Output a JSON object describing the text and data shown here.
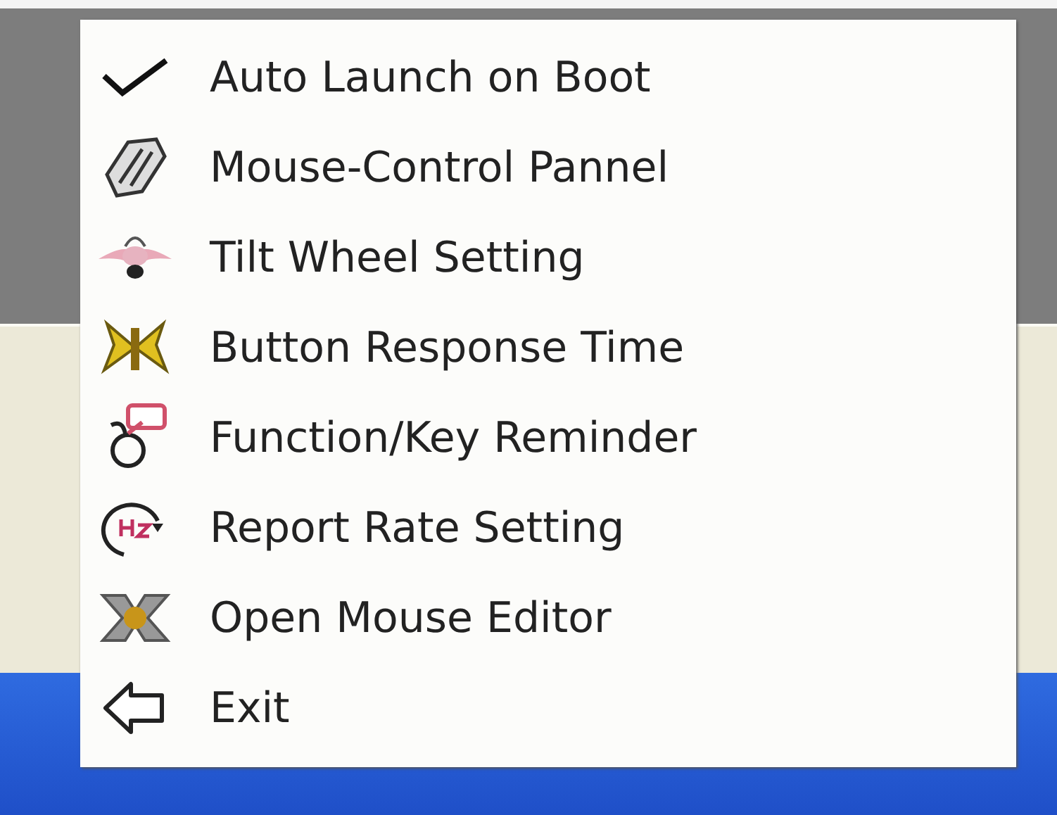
{
  "menu": {
    "items": [
      {
        "label": "Auto Launch on Boot",
        "kind": "check",
        "checked": true
      },
      {
        "label": "Mouse-Control Pannel",
        "kind": "mouse"
      },
      {
        "label": "Tilt Wheel Setting",
        "kind": "tilt"
      },
      {
        "label": "Button Response Time",
        "kind": "response"
      },
      {
        "label": "Function/Key Reminder",
        "kind": "reminder"
      },
      {
        "label": "Report Rate Setting",
        "kind": "hz"
      },
      {
        "label": "Open Mouse Editor",
        "kind": "editor"
      },
      {
        "label": "Exit",
        "kind": "exit"
      }
    ]
  }
}
